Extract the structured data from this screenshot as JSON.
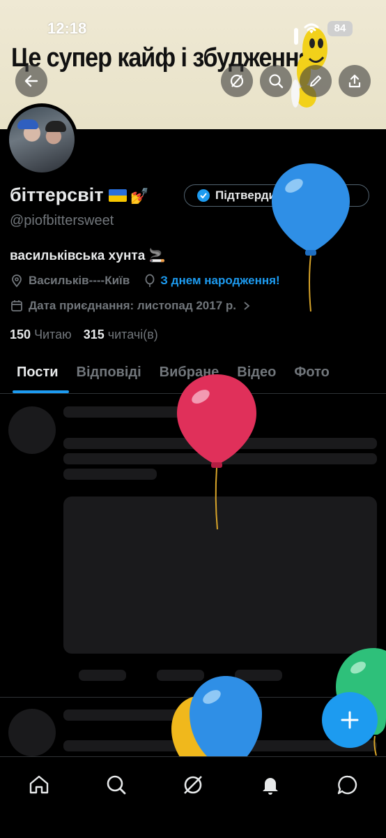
{
  "status_bar": {
    "time": "12:18",
    "battery": "84"
  },
  "banner": {
    "text": "Це супер кайф і збудження!"
  },
  "profile": {
    "display_name": "біттерсвіт",
    "handle": "@piofbittersweet",
    "bio": "васильківська хунта 🚬",
    "location": "Васильків----Київ",
    "birthday": "З днем народження!",
    "joined": "Дата приєднання: листопад 2017 р.",
    "following_count": "150",
    "following_label": "Читаю",
    "followers_count": "315",
    "followers_label": "читачі(в)",
    "verify_button": "Підтвердити профіль"
  },
  "tabs": [
    {
      "label": "Пости",
      "active": true
    },
    {
      "label": "Відповіді"
    },
    {
      "label": "Вибране"
    },
    {
      "label": "Відео"
    },
    {
      "label": "Фото"
    }
  ],
  "nav": {
    "items": [
      "home-icon",
      "search-icon",
      "grok-icon",
      "notifications-icon",
      "messages-icon"
    ]
  },
  "colors": {
    "accent": "#1d9bf0",
    "background": "#000000",
    "balloon_blue": "#2f8fe6",
    "balloon_red": "#e0305a",
    "balloon_green": "#2ec07a",
    "balloon_yellow": "#f0b81c"
  }
}
